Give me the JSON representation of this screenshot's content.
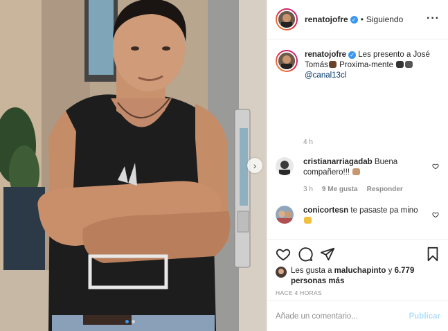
{
  "post": {
    "image_alt": "",
    "carousel_dots": 2,
    "active_dot": 1
  },
  "header": {
    "username": "renatojofre",
    "verified_icon": "verified-badge-icon",
    "separator": "•",
    "follow_status": "Siguiendo",
    "more_icon": "more-options-icon"
  },
  "caption": {
    "username": "renatojofre",
    "text_part1": "Les presento a José Tomás",
    "text_part2": " Proxima-mente ",
    "mention": "@canal13cl",
    "time": "4 h"
  },
  "comments": [
    {
      "username": "cristianarriagadab",
      "text": "Buena compañero!!!",
      "time": "3 h",
      "likes": "9 Me gusta",
      "reply": "Responder"
    },
    {
      "username": "conicortesn",
      "text": "te pasaste pa mino"
    }
  ],
  "actions": {
    "like_icon": "heart-icon",
    "comment_icon": "comment-icon",
    "share_icon": "share-icon",
    "save_icon": "bookmark-icon"
  },
  "likes": {
    "prefix": "Les gusta a ",
    "user": "maluchapinto",
    "middle": " y ",
    "others": "6.779 personas más"
  },
  "time_ago": "HACE 4 HORAS",
  "add_comment": {
    "placeholder": "Añade un comentario...",
    "post_label": "Publicar"
  },
  "colors": {
    "accent": "#3897f0",
    "mention": "#00376b",
    "muted": "#8e8e8e",
    "post_disabled": "#b2dffc"
  }
}
